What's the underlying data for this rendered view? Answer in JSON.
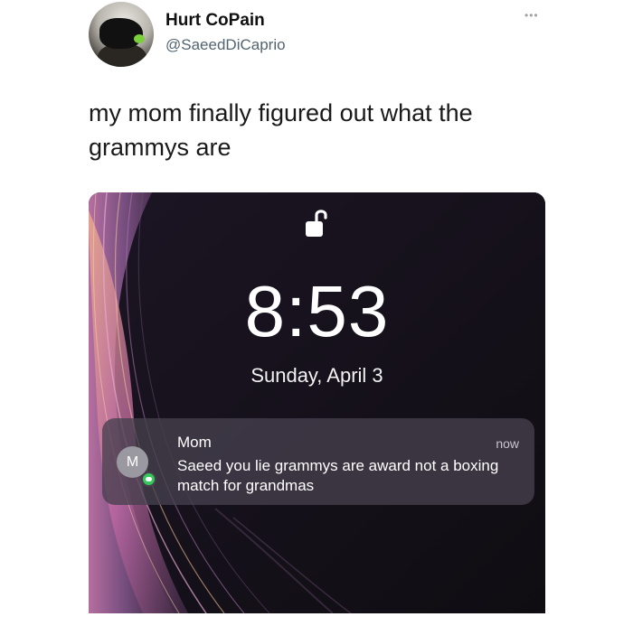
{
  "tweet": {
    "display_name": "Hurt CoPain",
    "handle": "@SaeedDiCaprio",
    "more_icon": "more-horizontal-icon",
    "text": "my mom finally figured out what the grammys are"
  },
  "lockscreen": {
    "lock_icon": "unlocked-padlock-icon",
    "time": "8:53",
    "date": "Sunday, April 3",
    "notification": {
      "sender": "Mom",
      "avatar_initial": "M",
      "timestamp": "now",
      "message": "Saeed you lie grammys are award not a boxing match for grandmas",
      "app_icon": "messages-icon",
      "app_color": "#36c85a"
    }
  },
  "colors": {
    "handle_gray": "#536471",
    "lockscreen_bg": "#16121b"
  }
}
